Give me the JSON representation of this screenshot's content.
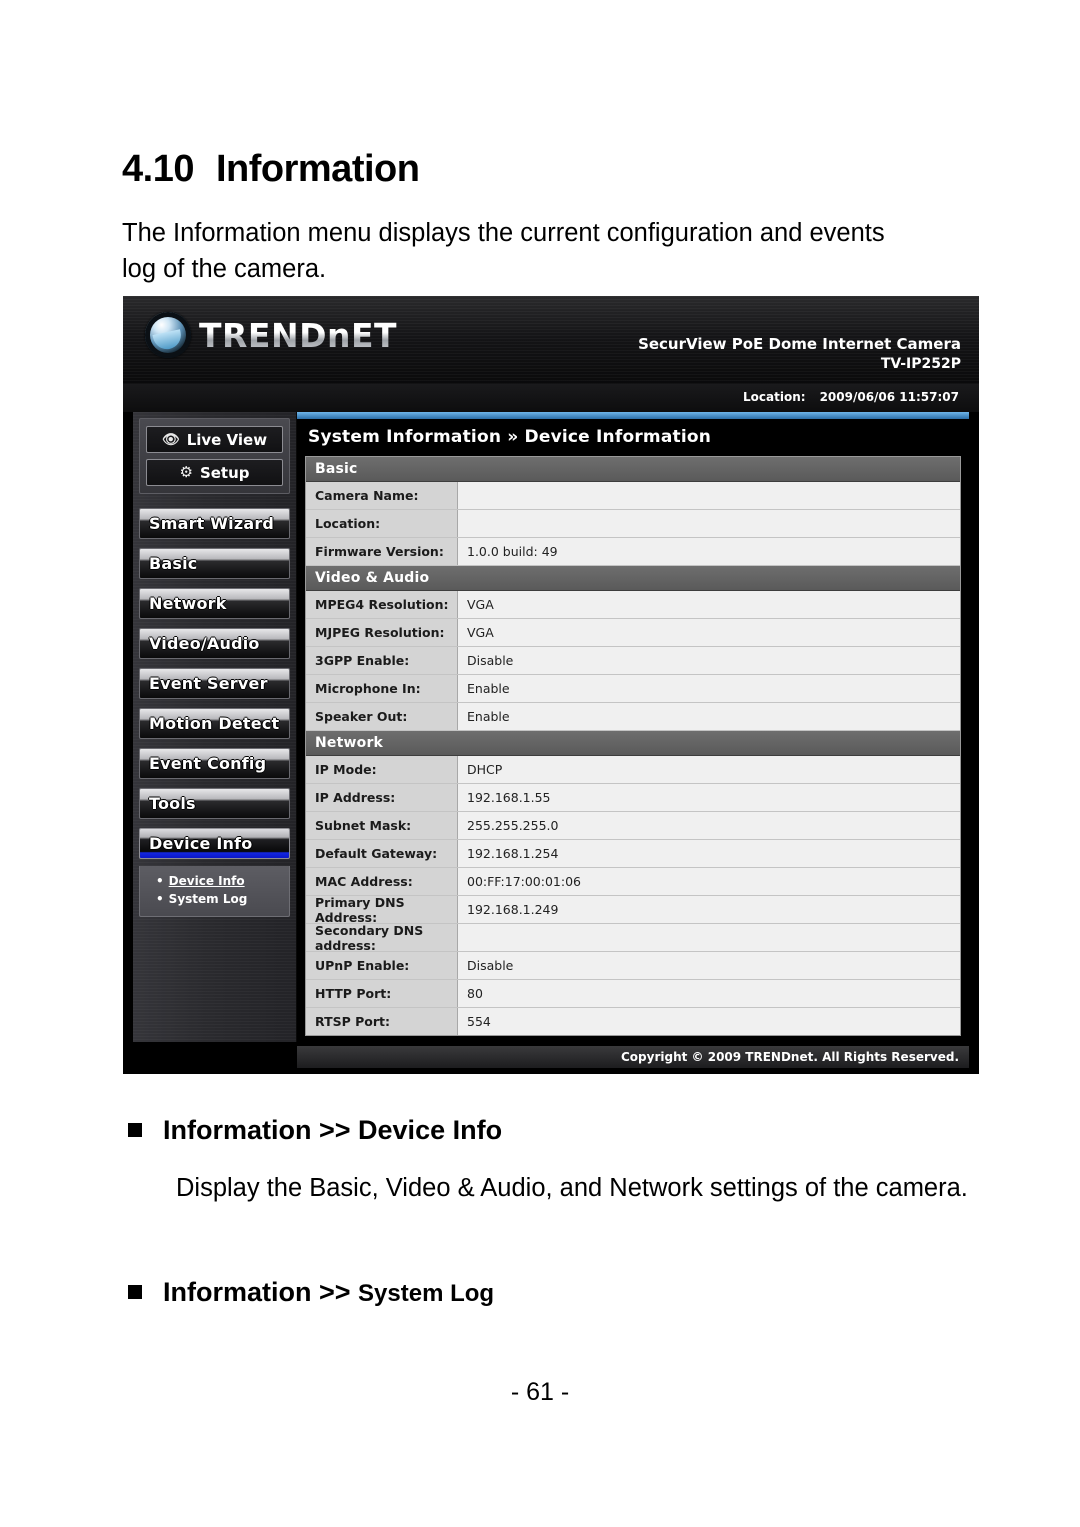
{
  "document": {
    "section_number": "4.10",
    "section_title": "Information",
    "intro": "The Information menu displays the current configuration and events log of the camera.",
    "page_number": "- 61 -",
    "bullets": [
      {
        "title_main": "Information >> ",
        "title_sub": "Device Info",
        "body": "Display the Basic, Video & Audio, and Network settings of the camera."
      },
      {
        "title_main": "Information >> ",
        "title_sub": "System Log",
        "body": ""
      }
    ]
  },
  "screenshot": {
    "header": {
      "brand": "TRENDnET",
      "product_name": "SecurView PoE Dome Internet Camera",
      "model": "TV-IP252P",
      "location_label": "Location:",
      "datetime": "2009/06/06 11:57:07"
    },
    "nav": {
      "top_buttons": [
        {
          "label": "Live View",
          "icon": "eye-icon"
        },
        {
          "label": "Setup",
          "icon": "gear-icon"
        }
      ],
      "items": [
        {
          "label": "Smart Wizard",
          "active": false
        },
        {
          "label": "Basic",
          "active": false
        },
        {
          "label": "Network",
          "active": false
        },
        {
          "label": "Video/Audio",
          "active": false
        },
        {
          "label": "Event Server",
          "active": false
        },
        {
          "label": "Motion Detect",
          "active": false
        },
        {
          "label": "Event Config",
          "active": false
        },
        {
          "label": "Tools",
          "active": false
        },
        {
          "label": "Device Info",
          "active": true
        }
      ],
      "submenu": [
        {
          "label": "Device Info",
          "current": true
        },
        {
          "label": "System Log",
          "current": false
        }
      ],
      "bullet_glyph": "•"
    },
    "panel": {
      "title": "System Information » Device Information",
      "sections": [
        {
          "heading": "Basic",
          "rows": [
            {
              "label": "Camera Name:",
              "value": ""
            },
            {
              "label": "Location:",
              "value": ""
            },
            {
              "label": "Firmware Version:",
              "value": "1.0.0 build: 49"
            }
          ]
        },
        {
          "heading": "Video & Audio",
          "rows": [
            {
              "label": "MPEG4 Resolution:",
              "value": "VGA"
            },
            {
              "label": "MJPEG Resolution:",
              "value": "VGA"
            },
            {
              "label": "3GPP Enable:",
              "value": "Disable"
            },
            {
              "label": "Microphone In:",
              "value": "Enable"
            },
            {
              "label": "Speaker Out:",
              "value": "Enable"
            }
          ]
        },
        {
          "heading": "Network",
          "rows": [
            {
              "label": "IP Mode:",
              "value": "DHCP"
            },
            {
              "label": "IP Address:",
              "value": "192.168.1.55"
            },
            {
              "label": "Subnet Mask:",
              "value": "255.255.255.0"
            },
            {
              "label": "Default Gateway:",
              "value": "192.168.1.254"
            },
            {
              "label": "MAC Address:",
              "value": "00:FF:17:00:01:06"
            },
            {
              "label": "Primary DNS Address:",
              "value": "192.168.1.249"
            },
            {
              "label": "Secondary DNS address:",
              "value": ""
            },
            {
              "label": "UPnP Enable:",
              "value": "Disable"
            },
            {
              "label": "HTTP Port:",
              "value": "80"
            },
            {
              "label": "RTSP Port:",
              "value": "554"
            }
          ]
        }
      ]
    },
    "footer": "Copyright © 2009 TRENDnet. All Rights Reserved.",
    "colors": {
      "accent_blue": "#2b6ea8",
      "active_underline": "#1427e0",
      "section_header_gray": "#5a5a5a",
      "label_cell": "#d4d4d4",
      "value_cell": "#f0f0f0"
    }
  }
}
